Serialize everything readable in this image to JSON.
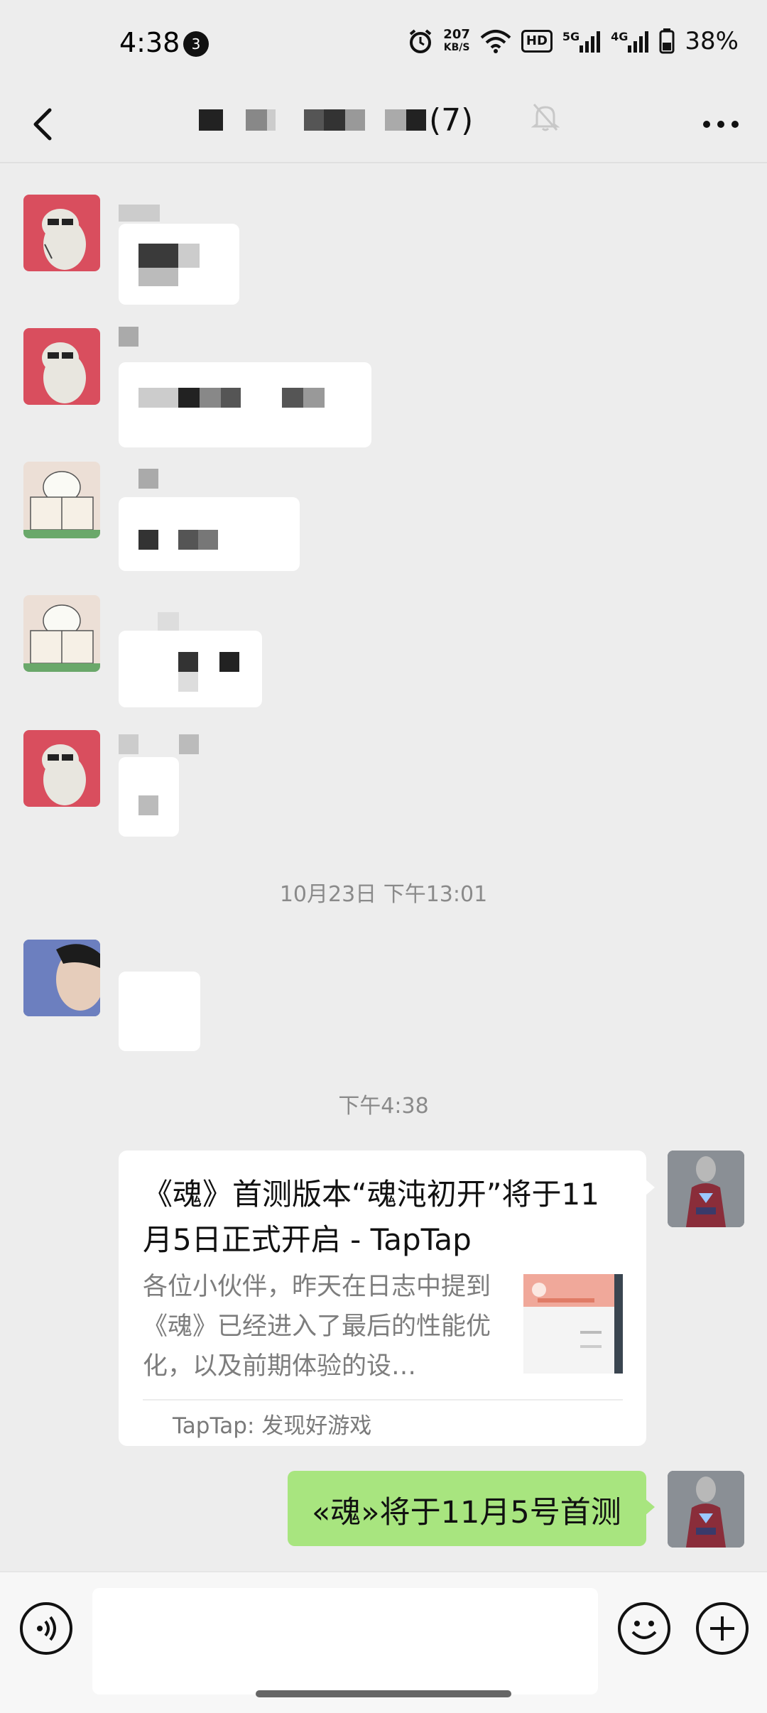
{
  "status_bar": {
    "time": "4:38",
    "notification_count": "3",
    "net_speed_value": "207",
    "net_speed_unit": "KB/S",
    "hd_label": "HD",
    "signal_1_label": "5G",
    "signal_2_label": "4G",
    "battery_percent": "38%"
  },
  "nav": {
    "member_count": "(7)",
    "icons": [
      "back-arrow-icon",
      "mute-bell-icon",
      "more-dots-icon"
    ]
  },
  "messages": {
    "timestamp_1": "10月23日 下午13:01",
    "timestamp_2": "下午4:38",
    "link_card": {
      "title": "《魂》首测版本“魂沌初开”将于11月5日正式开启 - TapTap",
      "description": "各位小伙伴，昨天在日志中提到《魂》已经进入了最后的性能优化，以及前期体验的设…",
      "source": "TapTap: 发现好游戏"
    },
    "sent_text": "«魂»将于11月5号首测"
  },
  "bottom_bar": {
    "icons": [
      "voice-icon",
      "emoji-icon",
      "plus-icon"
    ]
  },
  "colors": {
    "background": "#ededed",
    "sent_bubble": "#a8e57f",
    "received_bubble": "#ffffff"
  }
}
